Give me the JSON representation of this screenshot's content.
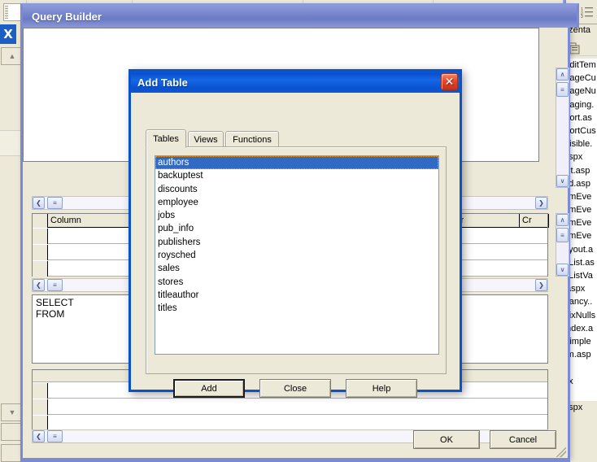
{
  "window": {
    "title": "Query Builder",
    "ok_label": "OK",
    "cancel_label": "Cancel"
  },
  "query_builder": {
    "grid_headers": [
      "",
      "Column",
      "Order",
      "Cr"
    ],
    "sql_lines": [
      "SELECT",
      "FROM"
    ],
    "scroll_left_glyph": "❮",
    "scroll_right_glyph": "❯",
    "scroll_up_glyph": "∧",
    "scroll_down_glyph": "∨",
    "thumb_glyph": "≡"
  },
  "dialog": {
    "title": "Add Table",
    "close_glyph": "✕",
    "tabs": [
      {
        "label": "Tables",
        "active": true
      },
      {
        "label": "Views",
        "active": false
      },
      {
        "label": "Functions",
        "active": false
      }
    ],
    "tables": [
      {
        "name": "authors",
        "selected": true
      },
      {
        "name": "backuptest",
        "selected": false
      },
      {
        "name": "discounts",
        "selected": false
      },
      {
        "name": "employee",
        "selected": false
      },
      {
        "name": "jobs",
        "selected": false
      },
      {
        "name": "pub_info",
        "selected": false
      },
      {
        "name": "publishers",
        "selected": false
      },
      {
        "name": "roysched",
        "selected": false
      },
      {
        "name": "sales",
        "selected": false
      },
      {
        "name": "stores",
        "selected": false
      },
      {
        "name": "titleauthor",
        "selected": false
      },
      {
        "name": "titles",
        "selected": false
      }
    ],
    "buttons": [
      {
        "label": "Add",
        "default": true
      },
      {
        "label": "Close",
        "default": false
      },
      {
        "label": "Help",
        "default": false
      }
    ]
  },
  "left_gutter": {
    "close_glyph": "X",
    "up_glyph": "▲",
    "down_glyph": "▼"
  },
  "right_panel": {
    "header": "ezenta",
    "files": [
      "EditTem",
      "PageCu",
      "PageNu",
      "Paging.",
      "Sort.as",
      "SortCus",
      "Visible.",
      "aspx",
      "dit.asp",
      "rid.asp",
      "emEve",
      "emEve",
      "emEve",
      "emEve",
      "ayout.a",
      "nList.as",
      "nListVa",
      ".aspx",
      "Fancy..",
      "FixNulls",
      "Index.a",
      "Simple",
      "rm.asp",
      "",
      "px",
      ":",
      "aspx"
    ],
    "selected_index": 26
  },
  "colors": {
    "dialog_title_blue": "#0a52c8",
    "window_title_blue": "#7583cb",
    "selection_blue": "#316ac5",
    "close_red": "#e2472a",
    "face": "#ece9d8"
  }
}
